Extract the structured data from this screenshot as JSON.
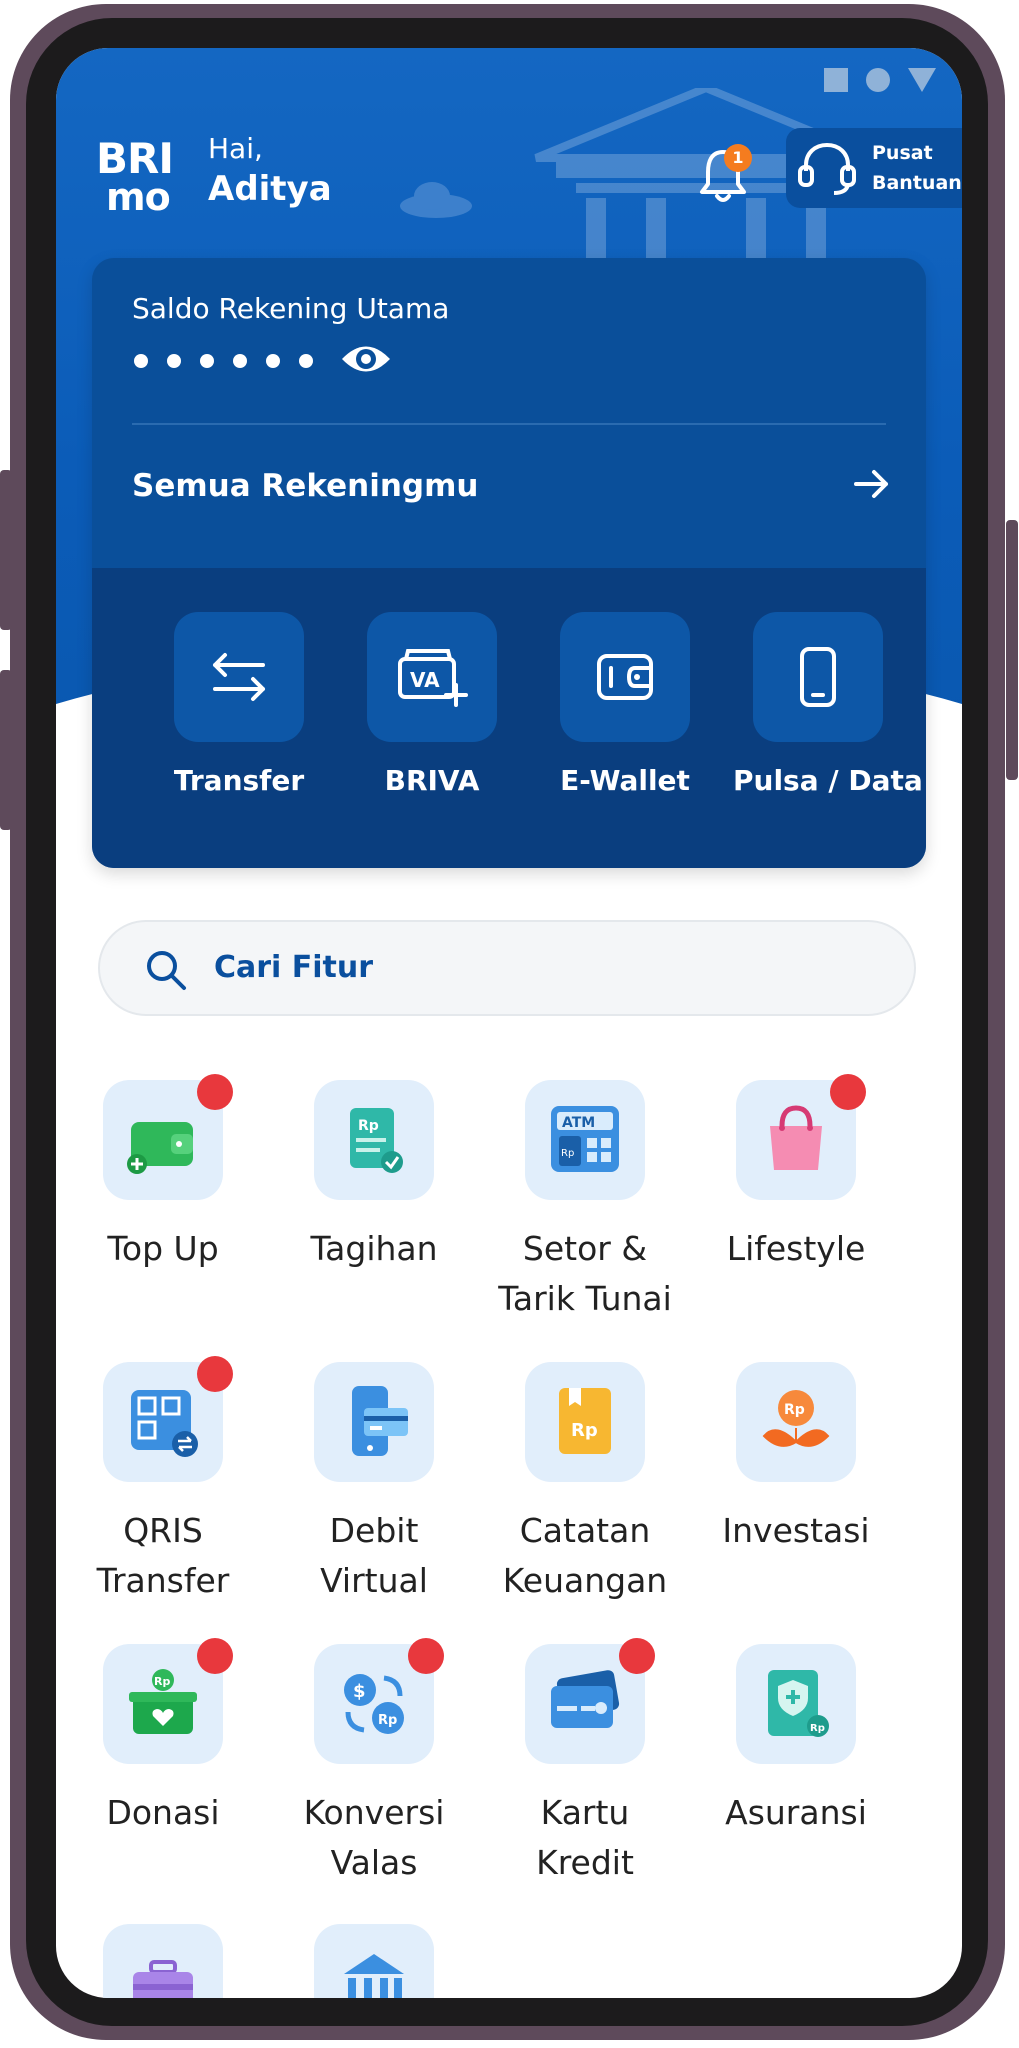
{
  "status_bar": {
    "icons": [
      "square-icon",
      "circle-icon",
      "triangle-icon"
    ]
  },
  "header": {
    "logo_line1": "BRI",
    "logo_line2": "mo",
    "greeting": "Hai,",
    "user_name": "Aditya",
    "notification_count": "1",
    "help_line1": "Pusat",
    "help_line2": "Bantuan"
  },
  "balance_card": {
    "label": "Saldo Rekening Utama",
    "masked_balance_dots": 6,
    "all_accounts_label": "Semua Rekeningmu"
  },
  "quick_actions": [
    {
      "label": "Transfer",
      "icon": "transfer-icon"
    },
    {
      "label": "BRIVA",
      "icon": "va-plus-icon"
    },
    {
      "label": "E-Wallet",
      "icon": "wallet-icon"
    },
    {
      "label": "Pulsa / Data",
      "icon": "phone-icon"
    }
  ],
  "search": {
    "placeholder": "Cari Fitur"
  },
  "menu": [
    {
      "line1": "Top Up",
      "line2": "",
      "icon": "wallet-topup-icon",
      "badge": true
    },
    {
      "line1": "Tagihan",
      "line2": "",
      "icon": "bill-icon",
      "badge": false
    },
    {
      "line1": "Setor &",
      "line2": "Tarik Tunai",
      "icon": "atm-icon",
      "badge": false
    },
    {
      "line1": "Lifestyle",
      "line2": "",
      "icon": "shopping-bag-icon",
      "badge": true
    },
    {
      "line1": "QRIS",
      "line2": "Transfer",
      "icon": "qris-icon",
      "badge": true
    },
    {
      "line1": "Debit",
      "line2": "Virtual",
      "icon": "debit-virtual-icon",
      "badge": false
    },
    {
      "line1": "Catatan",
      "line2": "Keuangan",
      "icon": "notebook-icon",
      "badge": false
    },
    {
      "line1": "Investasi",
      "line2": "",
      "icon": "investment-icon",
      "badge": false
    },
    {
      "line1": "Donasi",
      "line2": "",
      "icon": "donation-icon",
      "badge": true
    },
    {
      "line1": "Konversi",
      "line2": "Valas",
      "icon": "currency-exchange-icon",
      "badge": true
    },
    {
      "line1": "Kartu",
      "line2": "Kredit",
      "icon": "credit-card-icon",
      "badge": true
    },
    {
      "line1": "Asuransi",
      "line2": "",
      "icon": "insurance-icon",
      "badge": false
    },
    {
      "line1": "",
      "line2": "",
      "icon": "suitcase-icon",
      "badge": false
    },
    {
      "line1": "",
      "line2": "",
      "icon": "bank-building-icon",
      "badge": false
    }
  ],
  "colors": {
    "primary": "#0a4f9a",
    "header_blue": "#1467c2",
    "badge_red": "#e8383d",
    "notif_orange": "#f57c1f"
  }
}
